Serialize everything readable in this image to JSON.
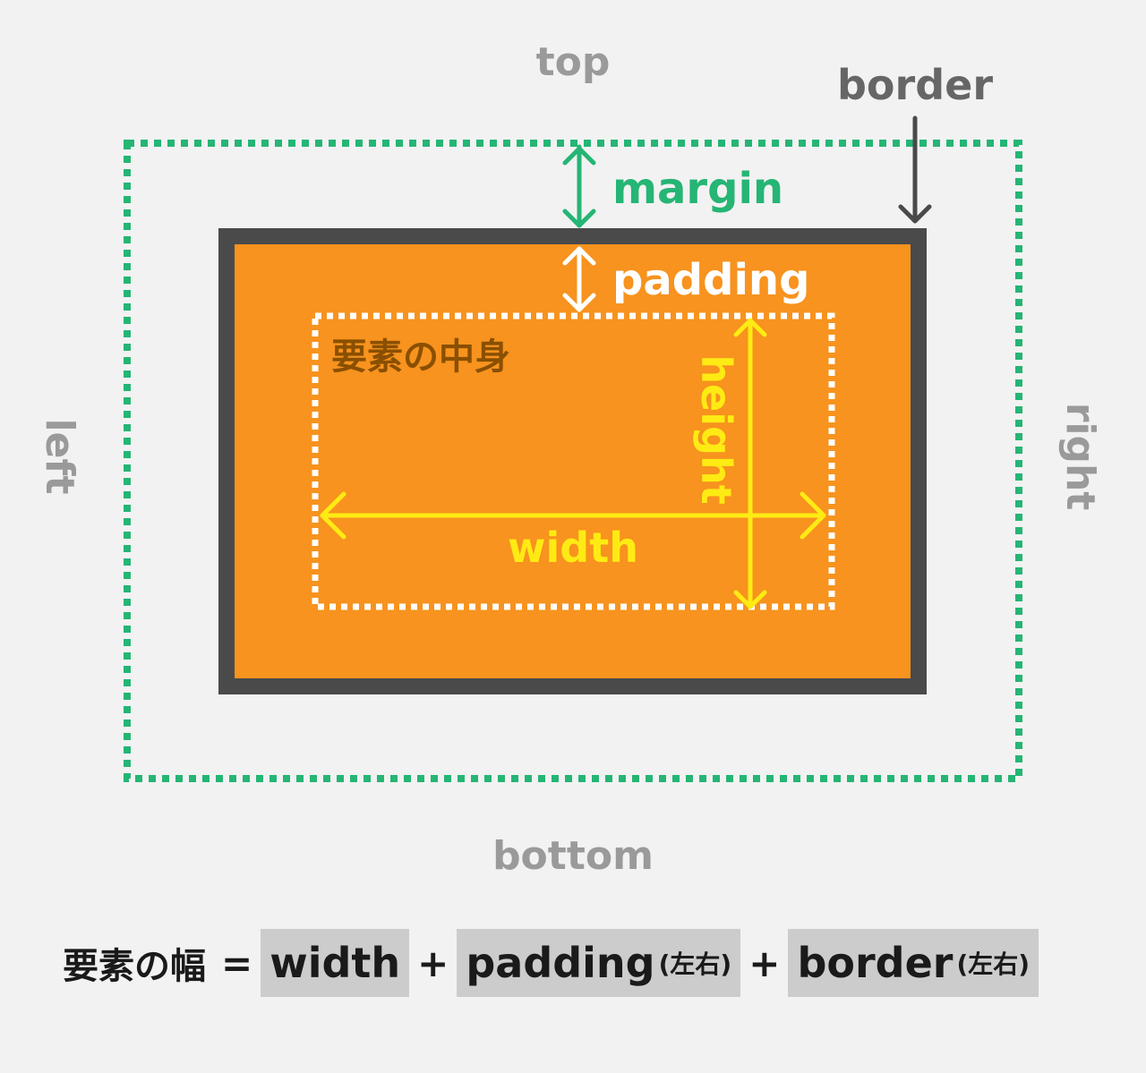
{
  "labels": {
    "top": "top",
    "bottom": "bottom",
    "left": "left",
    "right": "right",
    "border": "border",
    "margin": "margin",
    "padding": "padding",
    "content": "要素の中身",
    "height": "height",
    "width": "width"
  },
  "formula": {
    "lhs": "要素の幅",
    "equals": "=",
    "plus": "+",
    "term1": "width",
    "term2": "padding",
    "term2_suffix": "(左右)",
    "term3": "border",
    "term3_suffix": "(左右)"
  },
  "colors": {
    "background": "#f2f2f2",
    "margin": "#25b574",
    "border": "#4a4a4a",
    "padding_fill": "#f7931e",
    "content_outline": "#ffffff",
    "content_label": "#8a4f00",
    "dimension": "#ffeb14",
    "side_labels": "#9a9a9a",
    "formula_box": "#cccccc"
  }
}
